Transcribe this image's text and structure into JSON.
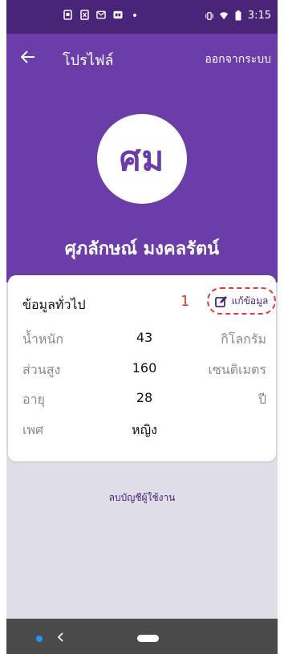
{
  "status_bar": {
    "time": "3:15",
    "icons_left": [
      "screenshot-icon",
      "excel-icon",
      "gmail-icon",
      "gb-icon",
      "notification-dot"
    ],
    "icons_right": [
      "vibrate-icon",
      "wifi-icon",
      "battery-icon"
    ]
  },
  "header": {
    "title": "โปรไฟล์",
    "logout_label": "ออกจากระบบ",
    "avatar_initials": "ศม",
    "full_name": "ศุภลักษณ์ มงคลรัตน์"
  },
  "card": {
    "title": "ข้อมูลทั่วไป",
    "marker": "1",
    "edit_label": "แก้ข้อมูล",
    "rows": [
      {
        "label": "น้ำหนัก",
        "value": "43",
        "unit": "กิโลกรัม"
      },
      {
        "label": "ส่วนสูง",
        "value": "160",
        "unit": "เซนติเมตร"
      },
      {
        "label": "อายุ",
        "value": "28",
        "unit": "ปี"
      },
      {
        "label": "เพศ",
        "value": "หญิง",
        "unit": ""
      }
    ]
  },
  "delete_account_label": "ลบบัญชีผู้ใช้งาน",
  "colors": {
    "primary": "#6a3da8",
    "status_bar": "#4a2478",
    "highlight": "#e53935"
  }
}
